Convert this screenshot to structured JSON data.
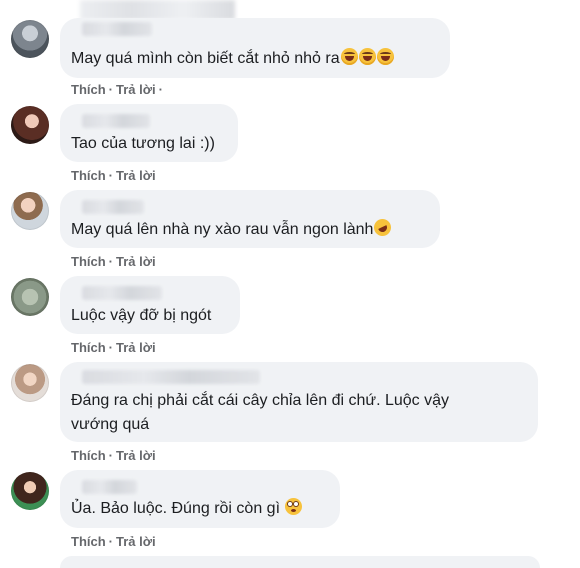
{
  "comments": [
    {
      "text": "May quá mình còn biết cắt nhỏ nhỏ ra",
      "emojis": [
        "grinning-squint-emoji",
        "grinning-squint-emoji",
        "grinning-squint-emoji"
      ],
      "actions": {
        "like": "Thích",
        "reply": "Trả lời",
        "trailing": "·"
      }
    },
    {
      "text": "Tao của tương lai :))",
      "emojis": [],
      "actions": {
        "like": "Thích",
        "reply": "Trả lời"
      }
    },
    {
      "text": "May quá lên nhà ny xào rau vẫn ngon lành",
      "emojis": [
        "rofl-emoji"
      ],
      "actions": {
        "like": "Thích",
        "reply": "Trả lời"
      }
    },
    {
      "text": "Luộc vậy đỡ bị ngót",
      "emojis": [],
      "actions": {
        "like": "Thích",
        "reply": "Trả lời"
      }
    },
    {
      "text": "Đáng ra chị phải cắt cái cây chỉa lên đi chứ. Luộc vậy\nvướng quá",
      "emojis": [],
      "actions": {
        "like": "Thích",
        "reply": "Trả lời"
      }
    },
    {
      "text": "Ủa. Bảo luộc. Đúng rồi còn gì",
      "emojis": [
        "flushed-emoji"
      ],
      "actions": {
        "like": "Thích",
        "reply": "Trả lời"
      }
    }
  ],
  "colors": {
    "bubble": "#f0f2f5",
    "text": "#1c1e21",
    "action": "#65676b"
  }
}
